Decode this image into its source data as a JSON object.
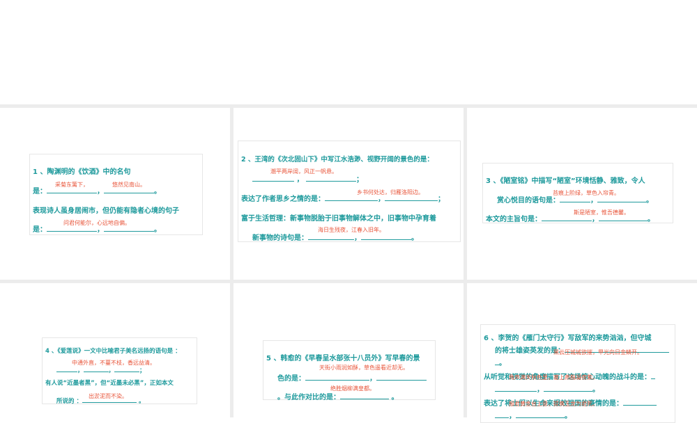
{
  "q1": {
    "l1": "1 、陶渊明的《饮酒》中的名句",
    "l2": "是：",
    "l3": "表现诗人虽身居闹市，但仍能有隐者心境的句子",
    "l4": "是：",
    "a1": "采菊东篱下，",
    "a2": "悠然见南山。",
    "a3": "问君何能尔，心远地自偏。"
  },
  "q2": {
    "l1": "2 、王湾的《次北固山下》中写江水浩渺、视野开阔的景色的是：",
    "l3": "表达了作者思乡之情的是：",
    "l4": "富于生活哲理：新事物脱胎于旧事物解体之中，旧事物中孕育着",
    "l5": "新事物的诗句是：",
    "a1": "潮平两岸阔，风正一帆悬。",
    "a2": "乡书何处达，归雁洛阳边。",
    "a3": "海日生残夜，江春入旧年。"
  },
  "q3": {
    "l1": "3 、《陋室铭》中描写“陋室”环境恬静、雅致，令人",
    "l2": "赏心悦目的语句是：",
    "l3": "本文的主旨句是：",
    "a1": "苔痕上阶绿，草色入帘青。",
    "a2": "斯是陋室，惟吾德馨。"
  },
  "q4": {
    "l1": "4 、《爱莲说》一文中比喻君子美名远扬的语句是 ：",
    "l3": "有人说“近墨者黑”，但“近墨未必黑”，正如本文",
    "l4": "所说的 ：",
    "a1": "中通外直，不蔓不枝，香远益清。",
    "a2": "出淤泥而不染。"
  },
  "q5": {
    "l1": "5 、韩愈的《早春呈水部张十八员外》写早春的景",
    "l2": "色的是：",
    "l3": "。与此作对比的是：",
    "a1": "天街小雨润如酥，草色遥看近却无。",
    "a2": "绝胜烟柳满皇都。"
  },
  "q6": {
    "l1": "6 、李贺的《雁门太守行》写敌军的来势汹汹，但守城",
    "l2": "的将士雄姿英发的是：",
    "l3": "从听觉和视觉的角度描写了这场惊心动魄的战斗的是：",
    "l4": "表达了将士们以生命来报效祖国的豪情的是：",
    "a1": "黑云压城城欲摧，甲光向日金鳞开。",
    "a2": "角声满天秋色里，塞上燕脂凝夜紫。",
    "a3": "报君黄金台上意，提携玉龙为君死。"
  },
  "punct": {
    "comma": "，",
    "period": "。",
    "semi": "；"
  }
}
